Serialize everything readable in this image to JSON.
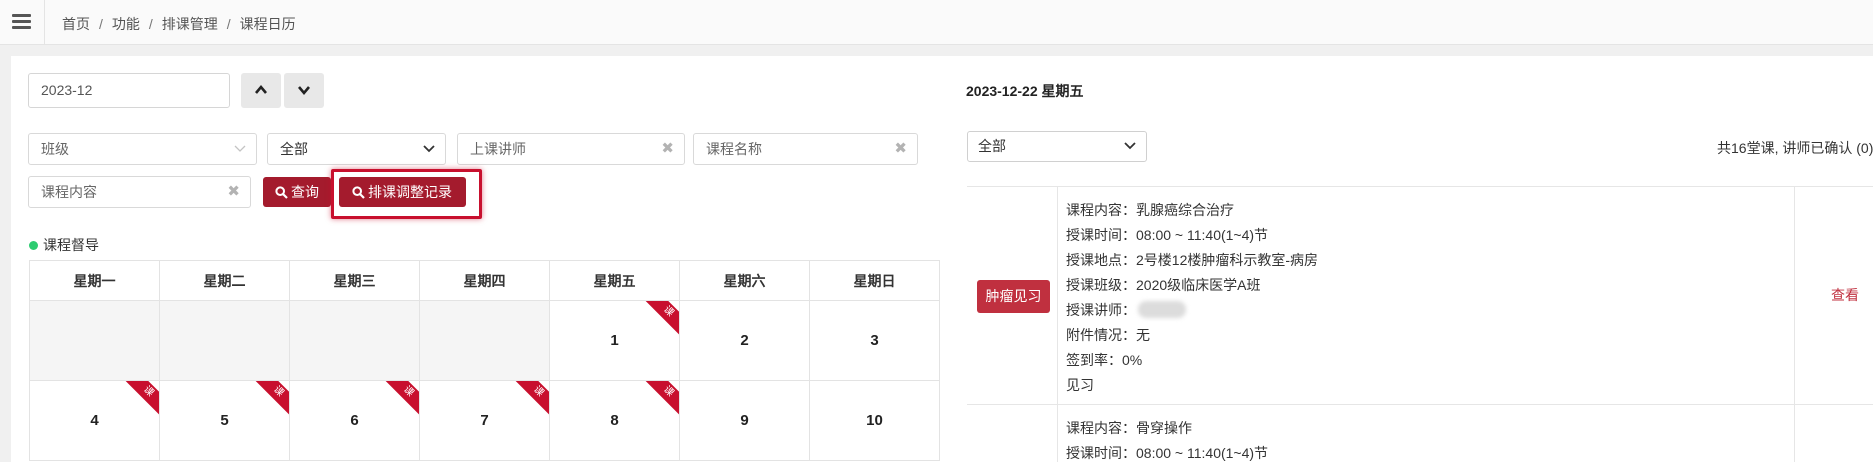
{
  "breadcrumb": {
    "home": "首页",
    "func": "功能",
    "scheduling": "排课管理",
    "current": "课程日历",
    "sep": "/"
  },
  "month_input": {
    "value": "2023-12"
  },
  "filters": {
    "class_placeholder": "班级",
    "scope_value": "全部",
    "lecturer_placeholder": "上课讲师",
    "course_name_placeholder": "课程名称",
    "course_content_placeholder": "课程内容",
    "clear_glyph": "✖"
  },
  "buttons": {
    "search": "查询",
    "adjust_log": "排课调整记录"
  },
  "supervise_label": "课程督导",
  "calendar": {
    "weekdays": [
      "星期一",
      "星期二",
      "星期三",
      "星期四",
      "星期五",
      "星期六",
      "星期日"
    ],
    "row1": [
      "",
      "",
      "",
      "",
      "1",
      "2",
      "3"
    ],
    "row2": [
      "4",
      "5",
      "6",
      "7",
      "8",
      "9",
      "10"
    ],
    "ribbon_label": "课"
  },
  "detail": {
    "date_title": "2023-12-22 星期五",
    "filter_value": "全部",
    "summary": "共16堂课, 讲师已确认 (0)",
    "card1": {
      "tag": "肿瘤见习",
      "content": "课程内容：乳腺癌综合治疗",
      "time": "授课时间：08:00 ~ 11:40(1~4)节",
      "location": "授课地点：2号楼12楼肿瘤科示教室-病房",
      "class": "授课班级：2020级临床医学A班",
      "lecturer": "授课讲师：",
      "attachment": "附件情况：无",
      "sign_rate": "签到率：0%",
      "type": "见习",
      "view": "查看"
    },
    "card2": {
      "content": "课程内容：骨穿操作",
      "time": "授课时间：08:00 ~ 11:40(1~4)节"
    }
  },
  "colors": {
    "primary": "#a41b2d",
    "ribbon": "#c8102e",
    "dot": "#2ecc71"
  }
}
